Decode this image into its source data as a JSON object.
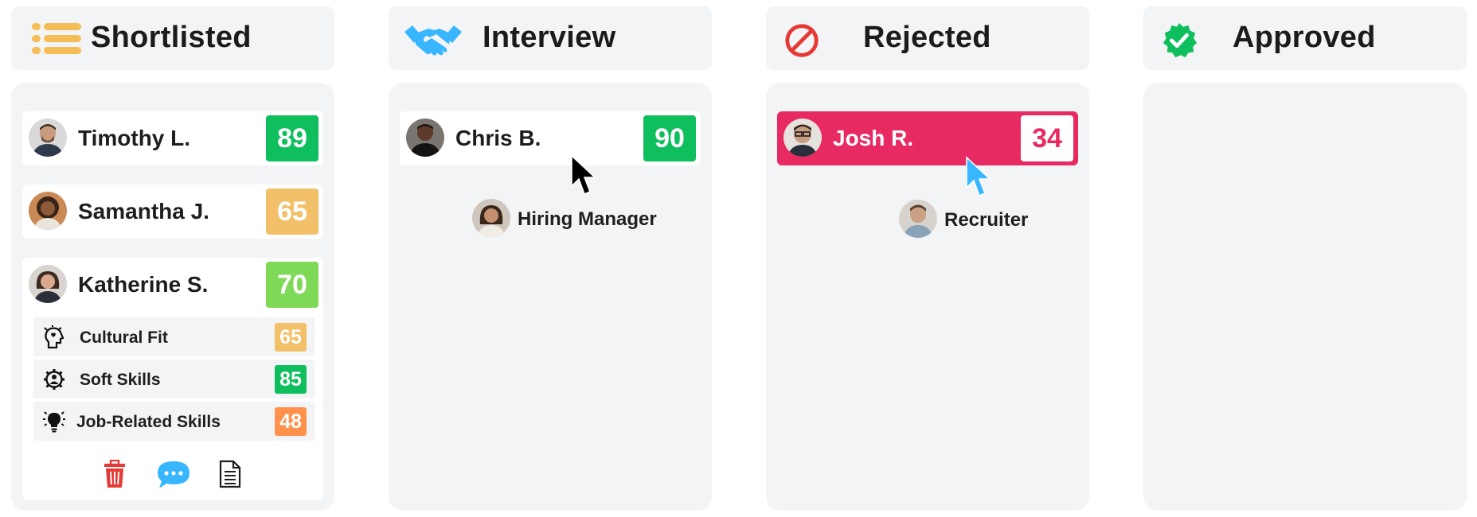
{
  "columns": [
    {
      "key": "shortlisted",
      "title": "Shortlisted",
      "icon": "list-icon"
    },
    {
      "key": "interview",
      "title": "Interview",
      "icon": "handshake-icon"
    },
    {
      "key": "rejected",
      "title": "Rejected",
      "icon": "prohibited-icon"
    },
    {
      "key": "approved",
      "title": "Approved",
      "icon": "verified-check-icon"
    }
  ],
  "shortlisted": {
    "cards": [
      {
        "name": "Timothy L.",
        "score": "89",
        "score_color": "#0fbf5d"
      },
      {
        "name": "Samantha J.",
        "score": "65",
        "score_color": "#f2c069"
      },
      {
        "name": "Katherine S.",
        "score": "70",
        "score_color": "#7ed957"
      }
    ],
    "skills": [
      {
        "label": "Cultural Fit",
        "score": "65",
        "score_color": "#f2c069",
        "icon": "head-heart-icon"
      },
      {
        "label": "Soft Skills",
        "score": "85",
        "score_color": "#0fbf5d",
        "icon": "gear-person-icon"
      },
      {
        "label": "Job-Related Skills",
        "score": "48",
        "score_color": "#ff914d",
        "icon": "lightbulb-icon"
      }
    ],
    "actions": [
      {
        "icon": "trash-icon",
        "color": "#e53935"
      },
      {
        "icon": "chat-icon",
        "color": "#38b6ff"
      },
      {
        "icon": "document-icon",
        "color": "#1e1e1e"
      }
    ]
  },
  "interview": {
    "cards": [
      {
        "name": "Chris B.",
        "score": "90",
        "score_color": "#0fbf5d"
      }
    ],
    "collaborator": {
      "label": "Hiring Manager",
      "cursor_color": "#000000"
    }
  },
  "rejected": {
    "cards": [
      {
        "name": "Josh R.",
        "score": "34",
        "card_color": "#e82a62",
        "score_text_color": "#e82a62"
      }
    ],
    "collaborator": {
      "label": "Recruiter",
      "cursor_color": "#38b6ff"
    }
  },
  "approved": {
    "cards": []
  },
  "colors": {
    "header_bg": "#f3f4f6",
    "column_bg": "#f3f4f6",
    "handshake": "#38b6ff",
    "prohibited": "#e53935",
    "verified": "#0fbf5d",
    "list": "#f5bd55"
  }
}
